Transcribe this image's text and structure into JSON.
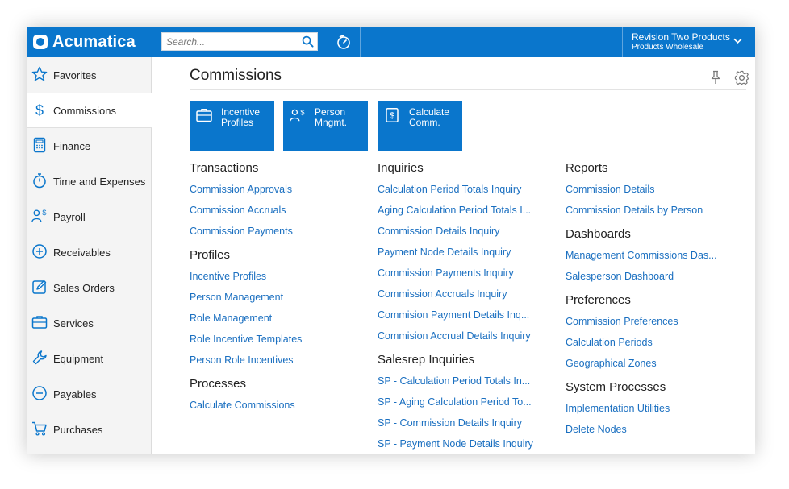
{
  "app": {
    "logo_text": "Acumatica"
  },
  "search": {
    "placeholder": "Search..."
  },
  "company": {
    "name": "Revision Two Products",
    "branch": "Products Wholesale"
  },
  "sidebar": {
    "items": [
      {
        "label": "Favorites",
        "icon": "star-icon"
      },
      {
        "label": "Commissions",
        "icon": "dollar-icon"
      },
      {
        "label": "Finance",
        "icon": "calculator-icon"
      },
      {
        "label": "Time and Expenses",
        "icon": "stopwatch-icon"
      },
      {
        "label": "Payroll",
        "icon": "person-dollar-icon"
      },
      {
        "label": "Receivables",
        "icon": "plus-circle-icon"
      },
      {
        "label": "Sales Orders",
        "icon": "edit-icon"
      },
      {
        "label": "Services",
        "icon": "briefcase-icon"
      },
      {
        "label": "Equipment",
        "icon": "wrench-icon"
      },
      {
        "label": "Payables",
        "icon": "minus-circle-icon"
      },
      {
        "label": "Purchases",
        "icon": "cart-icon"
      }
    ],
    "active_index": 1
  },
  "main": {
    "title": "Commissions",
    "tiles": [
      {
        "line1": "Incentive",
        "line2": "Profiles",
        "icon": "briefcase-icon"
      },
      {
        "line1": "Person",
        "line2": "Mngmt.",
        "icon": "person-dollar-icon"
      },
      {
        "line1": "Calculate",
        "line2": "Comm.",
        "icon": "dollar-doc-icon"
      }
    ],
    "columns": [
      {
        "sections": [
          {
            "title": "Transactions",
            "links": [
              "Commission Approvals",
              "Commission Accruals",
              "Commission Payments"
            ]
          },
          {
            "title": "Profiles",
            "links": [
              "Incentive Profiles",
              "Person Management",
              "Role Management",
              "Role Incentive Templates",
              "Person Role Incentives"
            ]
          },
          {
            "title": "Processes",
            "links": [
              "Calculate Commissions"
            ]
          }
        ]
      },
      {
        "sections": [
          {
            "title": "Inquiries",
            "links": [
              "Calculation Period Totals Inquiry",
              "Aging Calculation Period Totals I...",
              "Commission Details Inquiry",
              "Payment Node Details Inquiry",
              "Commission Payments Inquiry",
              "Commission Accruals Inquiry",
              "Commision Payment Details Inq...",
              "Commision Accrual Details Inquiry"
            ]
          },
          {
            "title": "Salesrep Inquiries",
            "links": [
              "SP - Calculation Period Totals In...",
              "SP - Aging Calculation Period To...",
              "SP - Commission Details Inquiry",
              "SP - Payment Node Details Inquiry"
            ]
          }
        ]
      },
      {
        "sections": [
          {
            "title": "Reports",
            "links": [
              "Commission Details",
              "Commission Details by Person"
            ]
          },
          {
            "title": "Dashboards",
            "links": [
              "Management Commissions Das...",
              "Salesperson Dashboard"
            ]
          },
          {
            "title": "Preferences",
            "links": [
              "Commission Preferences",
              "Calculation Periods",
              "Geographical Zones"
            ]
          },
          {
            "title": "System Processes",
            "links": [
              "Implementation Utilities",
              "Delete Nodes"
            ]
          }
        ]
      }
    ]
  },
  "colors": {
    "brand": "#0a76cc",
    "link": "#1a6fc0",
    "sidebar_bg": "#f4f4f4"
  }
}
